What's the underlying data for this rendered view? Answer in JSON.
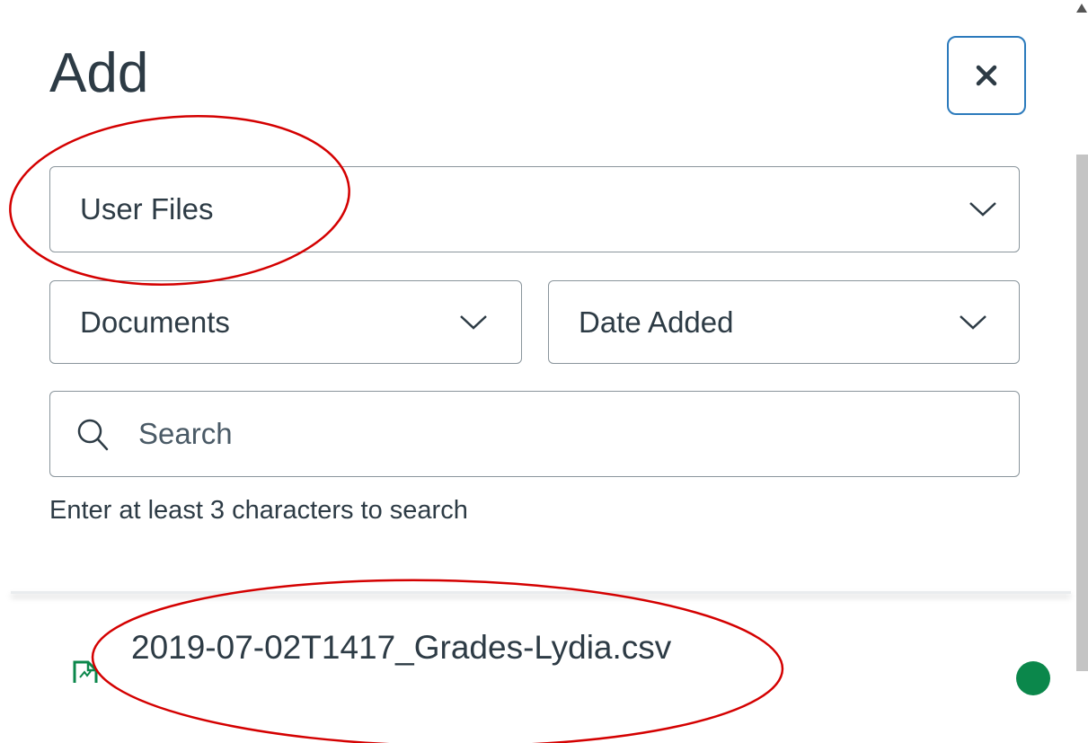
{
  "dialog": {
    "title": "Add",
    "close_icon": "close-icon"
  },
  "filters": {
    "source": {
      "value": "User Files",
      "icon": "chevron-down-icon"
    },
    "type": {
      "value": "Documents",
      "icon": "chevron-down-icon"
    },
    "sort": {
      "value": "Date Added",
      "icon": "chevron-down-icon"
    }
  },
  "search": {
    "placeholder": "Search",
    "value": "",
    "icon": "search-icon",
    "hint": "Enter at least 3 characters to search"
  },
  "files": [
    {
      "name": "2019-07-02T1417_Grades-Lydia.csv",
      "icon": "document-icon",
      "status_color": "#0b874b"
    }
  ],
  "colors": {
    "text": "#2d3b45",
    "accent": "#2b7abc",
    "border": "#8a959c",
    "annotation": "#d40000",
    "status": "#0b874b"
  }
}
